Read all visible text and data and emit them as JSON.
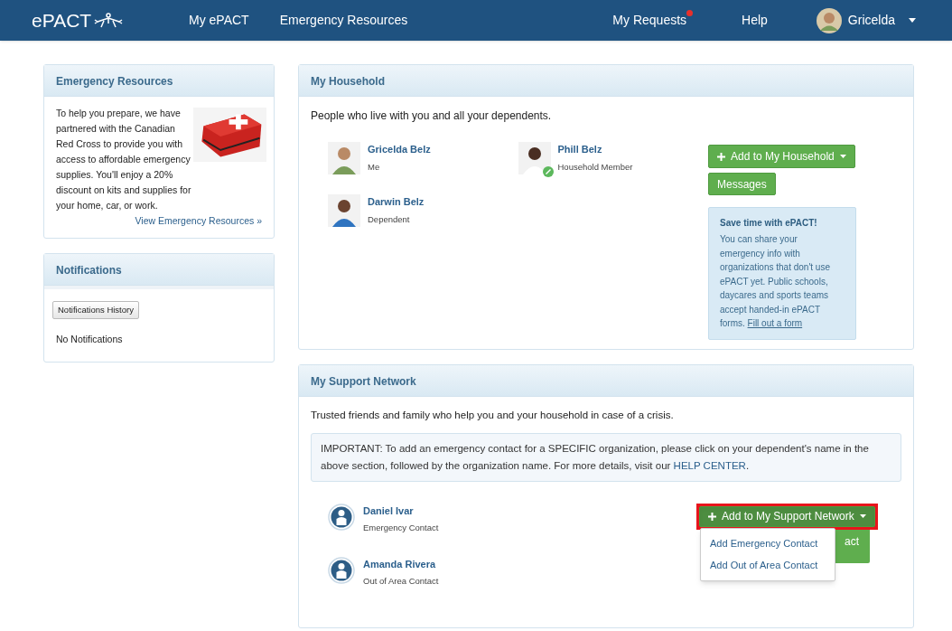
{
  "nav": {
    "logo": "ePACT",
    "links": [
      {
        "label": "My ePACT"
      },
      {
        "label": "Emergency Resources"
      }
    ],
    "right_links": [
      {
        "label": "My Requests",
        "alert": true
      },
      {
        "label": "Help",
        "alert": false
      }
    ],
    "user": {
      "name": "Gricelda"
    }
  },
  "emergency_resources": {
    "title": "Emergency Resources",
    "text": "To help you prepare, we have partnered with the Canadian Red Cross to provide you with access to affordable emergency supplies. You'll enjoy a 20% discount on kits and supplies for your home, car, or work.",
    "link": "View Emergency Resources »"
  },
  "notifications": {
    "title": "Notifications",
    "button": "Notifications History",
    "empty": "No Notifications"
  },
  "household": {
    "title": "My Household",
    "intro": "People who live with you and all your dependents.",
    "members": [
      {
        "name": "Gricelda Belz",
        "role": "Me",
        "linked": false
      },
      {
        "name": "Phill Belz",
        "role": "Household Member",
        "linked": true
      },
      {
        "name": "Darwin Belz",
        "role": "Dependent",
        "linked": false
      }
    ],
    "add_button": "Add to My Household",
    "messages_button": "Messages",
    "tip": {
      "title": "Save time with ePACT!",
      "text": "You can share your emergency info with organizations that don't use ePACT yet. Public schools, daycares and sports teams accept handed-in ePACT forms.",
      "link": "Fill out a form"
    }
  },
  "support": {
    "title": "My Support Network",
    "intro": "Trusted friends and family who help you and your household in case of a crisis.",
    "notice": "IMPORTANT: To add an emergency contact for a SPECIFIC organization, please click on your dependent's name in the above section, followed by the organization name. For more details, visit our",
    "notice_link": "HELP CENTER",
    "notice_end": ".",
    "contacts": [
      {
        "name": "Daniel Ivar",
        "role": "Emergency Contact"
      },
      {
        "name": "Amanda Rivera",
        "role": "Out of Area Contact"
      }
    ],
    "add_button": {
      "label": "Add to My Support Network",
      "expanded": true,
      "highlighted": true
    },
    "hidden_button": "act",
    "menu": [
      "Add Emergency Contact",
      "Add Out of Area Contact"
    ]
  }
}
